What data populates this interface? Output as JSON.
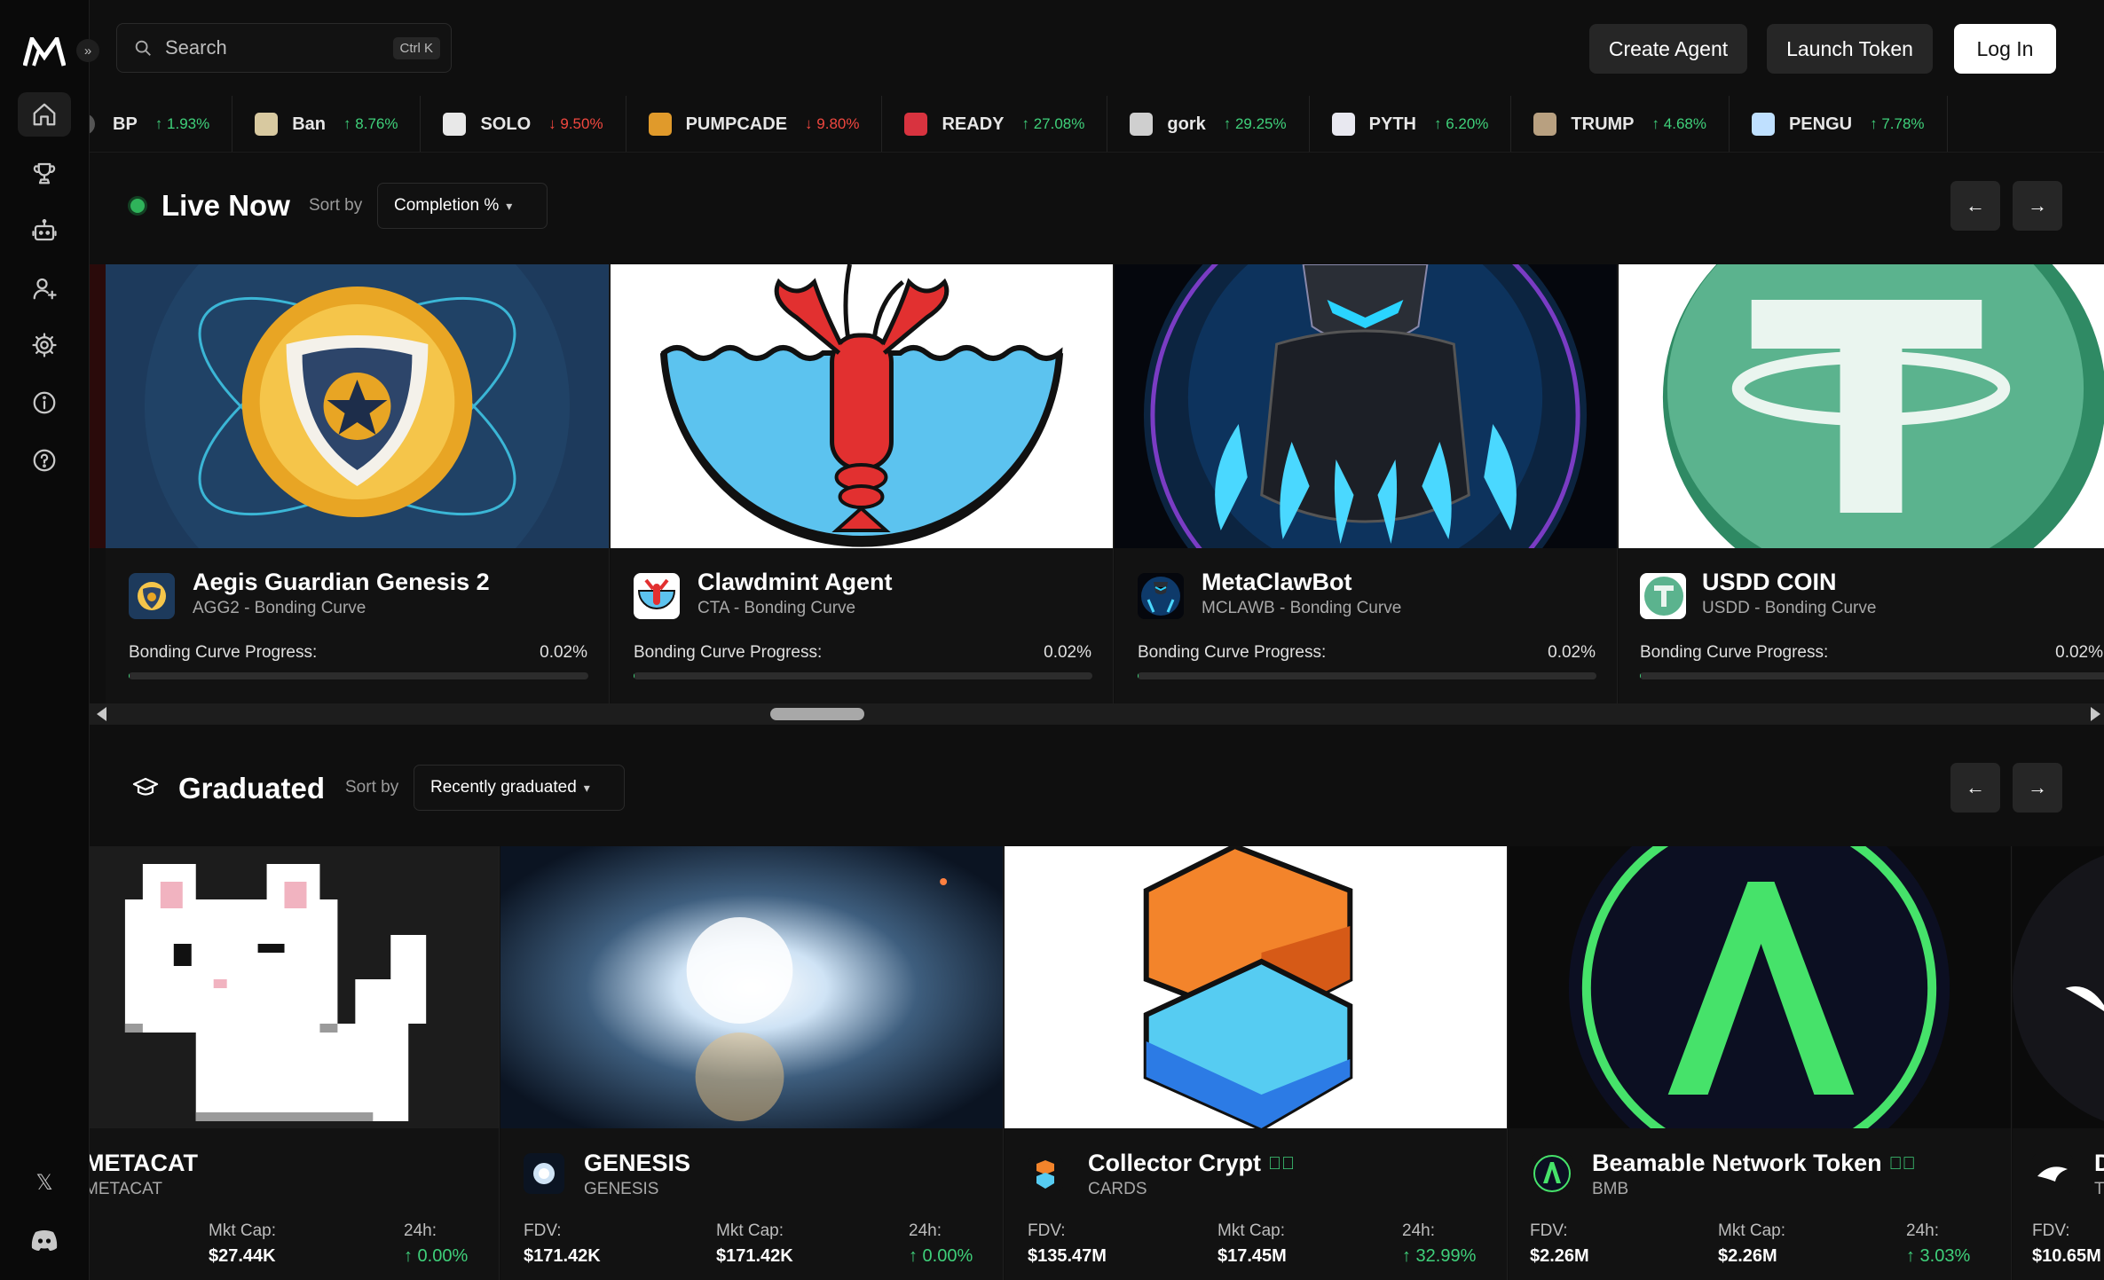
{
  "sidebar": {
    "expand_glyph": "»",
    "nav": [
      {
        "name": "home-icon",
        "active": true
      },
      {
        "name": "trophy-icon",
        "active": false
      },
      {
        "name": "robot-icon",
        "active": false
      },
      {
        "name": "user-add-icon",
        "active": false
      },
      {
        "name": "gear-icon",
        "active": false
      },
      {
        "name": "info-icon",
        "active": false
      },
      {
        "name": "help-icon",
        "active": false
      }
    ],
    "x_glyph": "𝕏"
  },
  "header": {
    "search_placeholder": "Search",
    "search_shortcut": "Ctrl K",
    "create_agent": "Create Agent",
    "launch_token": "Launch Token",
    "login": "Log In"
  },
  "ticker": [
    {
      "symbol": "BP",
      "change": "1.93%",
      "dir": "up",
      "color": "#555555"
    },
    {
      "symbol": "Ban",
      "change": "8.76%",
      "dir": "up",
      "color": "#d8c9a0"
    },
    {
      "symbol": "SOLO",
      "change": "9.50%",
      "dir": "down",
      "color": "#e8e8e8"
    },
    {
      "symbol": "PUMPCADE",
      "change": "9.80%",
      "dir": "down",
      "color": "#e09a2b"
    },
    {
      "symbol": "READY",
      "change": "27.08%",
      "dir": "up",
      "color": "#d8333f"
    },
    {
      "symbol": "gork",
      "change": "29.25%",
      "dir": "up",
      "color": "#cfcfcf"
    },
    {
      "symbol": "PYTH",
      "change": "6.20%",
      "dir": "up",
      "color": "#e8e8f0"
    },
    {
      "symbol": "TRUMP",
      "change": "4.68%",
      "dir": "up",
      "color": "#b8a080"
    },
    {
      "symbol": "PENGU",
      "change": "7.78%",
      "dir": "up",
      "color": "#bfe0ff"
    }
  ],
  "live": {
    "title": "Live Now",
    "sort_label": "Sort by",
    "sort_value": "Completion %",
    "prev": "←",
    "next": "→",
    "cards": [
      {
        "name": "Aegis Guardian Genesis 2",
        "sub": "AGG2 - Bonding Curve",
        "progress_label": "Bonding Curve Progress:",
        "progress": "0.02%",
        "progress_fraction": 0.0002
      },
      {
        "name": "Clawdmint Agent",
        "sub": "CTA - Bonding Curve",
        "progress_label": "Bonding Curve Progress:",
        "progress": "0.02%",
        "progress_fraction": 0.0002
      },
      {
        "name": "MetaClawBot",
        "sub": "MCLAWB - Bonding Curve",
        "progress_label": "Bonding Curve Progress:",
        "progress": "0.02%",
        "progress_fraction": 0.0002
      },
      {
        "name": "USDD COIN",
        "sub": "USDD - Bonding Curve",
        "progress_label": "Bonding Curve Progress:",
        "progress": "0.02%",
        "progress_fraction": 0.0002
      }
    ]
  },
  "graduated": {
    "title": "Graduated",
    "sort_label": "Sort by",
    "sort_value": "Recently graduated",
    "prev": "←",
    "next": "→",
    "cards": [
      {
        "name": "METACAT",
        "sub": "METACAT",
        "verified": false,
        "mktcap_label": "Mkt Cap:",
        "mktcap": "$27.44K",
        "chg_label": "24h:",
        "chg": "↑ 0.00%"
      },
      {
        "name": "GENESIS",
        "sub": "GENESIS",
        "verified": false,
        "fdv_label": "FDV:",
        "fdv": "$171.42K",
        "mktcap_label": "Mkt Cap:",
        "mktcap": "$171.42K",
        "chg_label": "24h:",
        "chg": "↑ 0.00%"
      },
      {
        "name": "Collector Crypt",
        "sub": "CARDS",
        "verified": true,
        "fdv_label": "FDV:",
        "fdv": "$135.47M",
        "mktcap_label": "Mkt Cap:",
        "mktcap": "$17.45M",
        "chg_label": "24h:",
        "chg": "↑ 32.99%"
      },
      {
        "name": "Beamable Network Token",
        "sub": "BMB",
        "verified": true,
        "fdv_label": "FDV:",
        "fdv": "$2.26M",
        "mktcap_label": "Mkt Cap:",
        "mktcap": "$2.26M",
        "chg_label": "24h:",
        "chg": "↑ 3.03%"
      },
      {
        "name": "D",
        "sub": "T",
        "verified": false,
        "fdv_label": "FDV:",
        "fdv": "$10.65M"
      }
    ]
  },
  "colors": {
    "accent_green": "#3fd07a",
    "accent_red": "#f0473f",
    "bg": "#0f0f0f"
  }
}
